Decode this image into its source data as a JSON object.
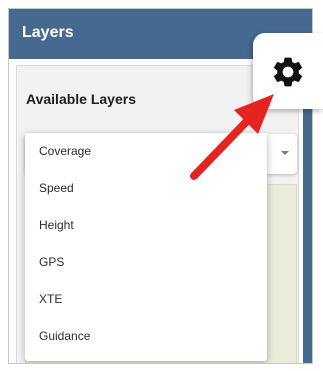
{
  "header": {
    "title": "Layers"
  },
  "panel": {
    "title": "Available Layers"
  },
  "layer_select": {
    "selected": "Coverage",
    "options": [
      "Coverage",
      "Speed",
      "Height",
      "GPS",
      "XTE",
      "Guidance"
    ]
  },
  "icons": {
    "settings": "gear-icon",
    "caret": "chevron-down-icon",
    "annotation": "red-arrow-icon"
  },
  "colors": {
    "header": "#46698f",
    "arrow": "#e52421",
    "icon": "#111111"
  }
}
